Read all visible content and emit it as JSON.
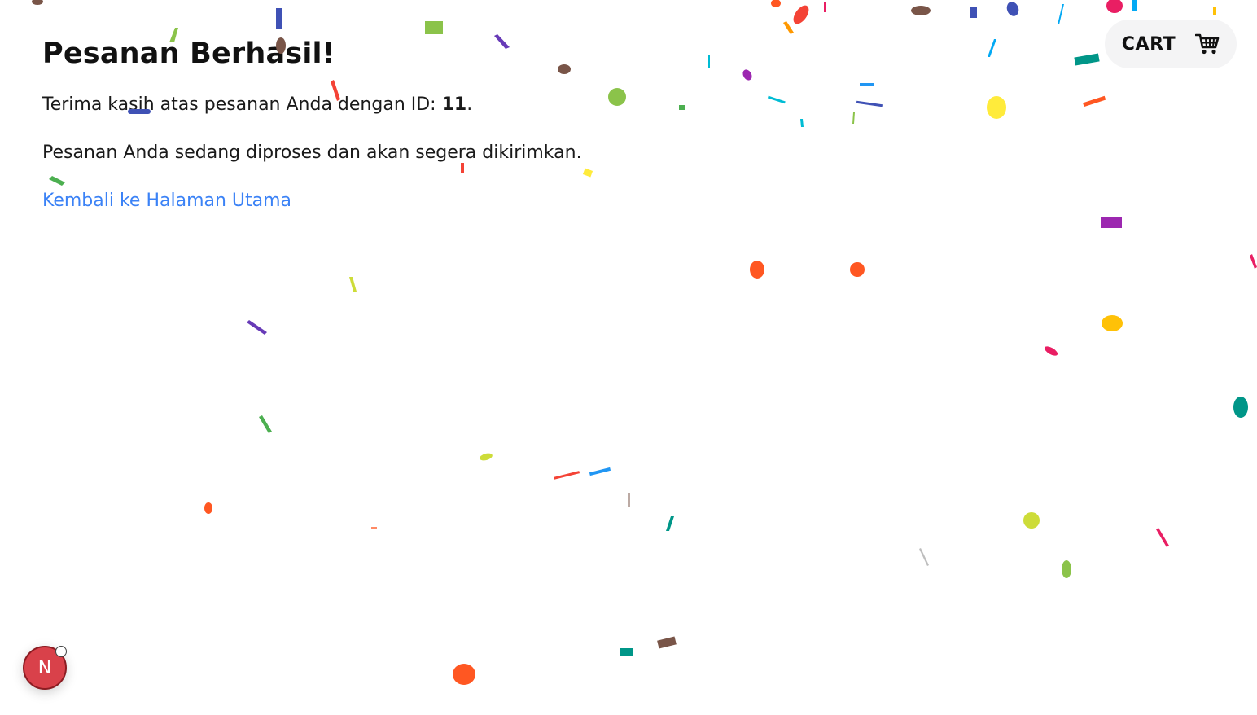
{
  "main": {
    "title": "Pesanan Berhasil!",
    "thanks_prefix": "Terima kasih atas pesanan Anda dengan ID: ",
    "order_id": "11",
    "thanks_suffix": ".",
    "processing_text": "Pesanan Anda sedang diproses dan akan segera dikirimkan.",
    "home_link": "Kembali ke Halaman Utama"
  },
  "header": {
    "cart_label": "CART",
    "cart_icon": "cart-icon"
  },
  "dev_badge": {
    "letter": "N",
    "icon": "nextjs-dev-indicator-icon"
  },
  "colors": {
    "link": "#3b82f6",
    "cart_bg": "#f4f4f5",
    "badge": "#d9414a"
  }
}
